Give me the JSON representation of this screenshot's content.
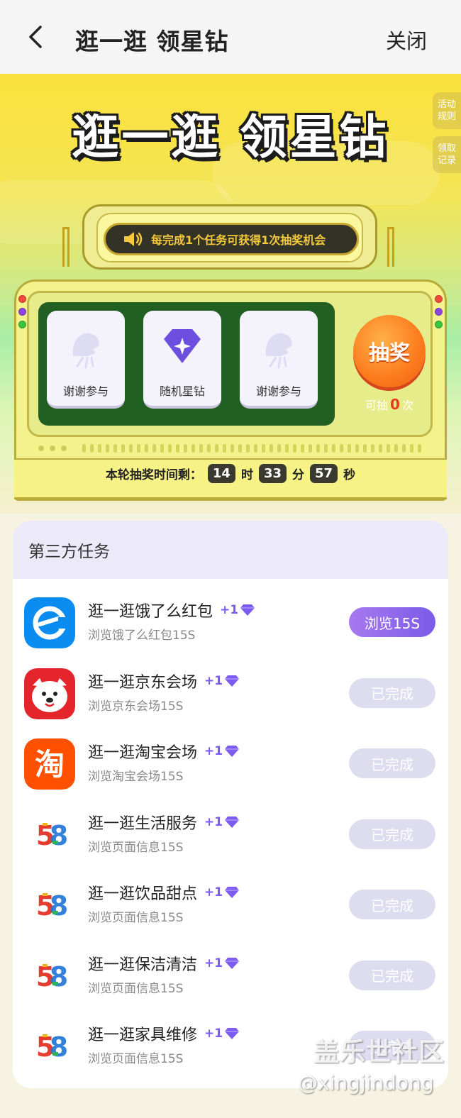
{
  "header": {
    "title": "逛一逛 领星钻",
    "close_label": "关闭"
  },
  "hero": {
    "title": "逛一逛 领星钻",
    "side_tabs": [
      "活动\n规则",
      "领取\n记录"
    ],
    "notice": "每完成1个任务可获得1次抽奖机会",
    "prize_cards": [
      "谢谢参与",
      "随机星钻",
      "谢谢参与"
    ],
    "draw_label": "抽奖",
    "draw_prefix": "可抽",
    "draw_count": "0",
    "draw_suffix": "次",
    "timer_label": "本轮抽奖时间剩：",
    "timer": {
      "hours": "14",
      "hours_unit": "时",
      "minutes": "33",
      "minutes_unit": "分",
      "seconds": "57",
      "seconds_unit": "秒"
    }
  },
  "tasks": {
    "section_title": "第三方任务",
    "items": [
      {
        "title": "逛一逛饿了么红包",
        "reward": "+1",
        "subtitle": "浏览饿了么红包15S",
        "button": "浏览15S",
        "state": "active",
        "logo": "eleme-logo"
      },
      {
        "title": "逛一逛京东会场",
        "reward": "+1",
        "subtitle": "浏览京东会场15S",
        "button": "已完成",
        "state": "done",
        "logo": "jd-logo"
      },
      {
        "title": "逛一逛淘宝会场",
        "reward": "+1",
        "subtitle": "浏览淘宝会场15S",
        "button": "已完成",
        "state": "done",
        "logo": "taobao-logo"
      },
      {
        "title": "逛一逛生活服务",
        "reward": "+1",
        "subtitle": "浏览页面信息15S",
        "button": "已完成",
        "state": "done",
        "logo": "58-logo"
      },
      {
        "title": "逛一逛饮品甜点",
        "reward": "+1",
        "subtitle": "浏览页面信息15S",
        "button": "已完成",
        "state": "done",
        "logo": "58-logo"
      },
      {
        "title": "逛一逛保洁清洁",
        "reward": "+1",
        "subtitle": "浏览页面信息15S",
        "button": "已完成",
        "state": "done",
        "logo": "58-logo"
      },
      {
        "title": "逛一逛家具维修",
        "reward": "+1",
        "subtitle": "浏览页面信息15S",
        "button": "已完成",
        "state": "done",
        "logo": "58-logo"
      }
    ]
  },
  "logo_text": {
    "taobao": "淘",
    "five_eight": [
      "5",
      "8"
    ]
  },
  "watermark": {
    "line1": "盖乐世社区",
    "line2": "@xingjindong"
  },
  "colors": {
    "accent": "#7b5be7",
    "done_button": "#dedcef",
    "draw_button": "#fc7b1c"
  }
}
